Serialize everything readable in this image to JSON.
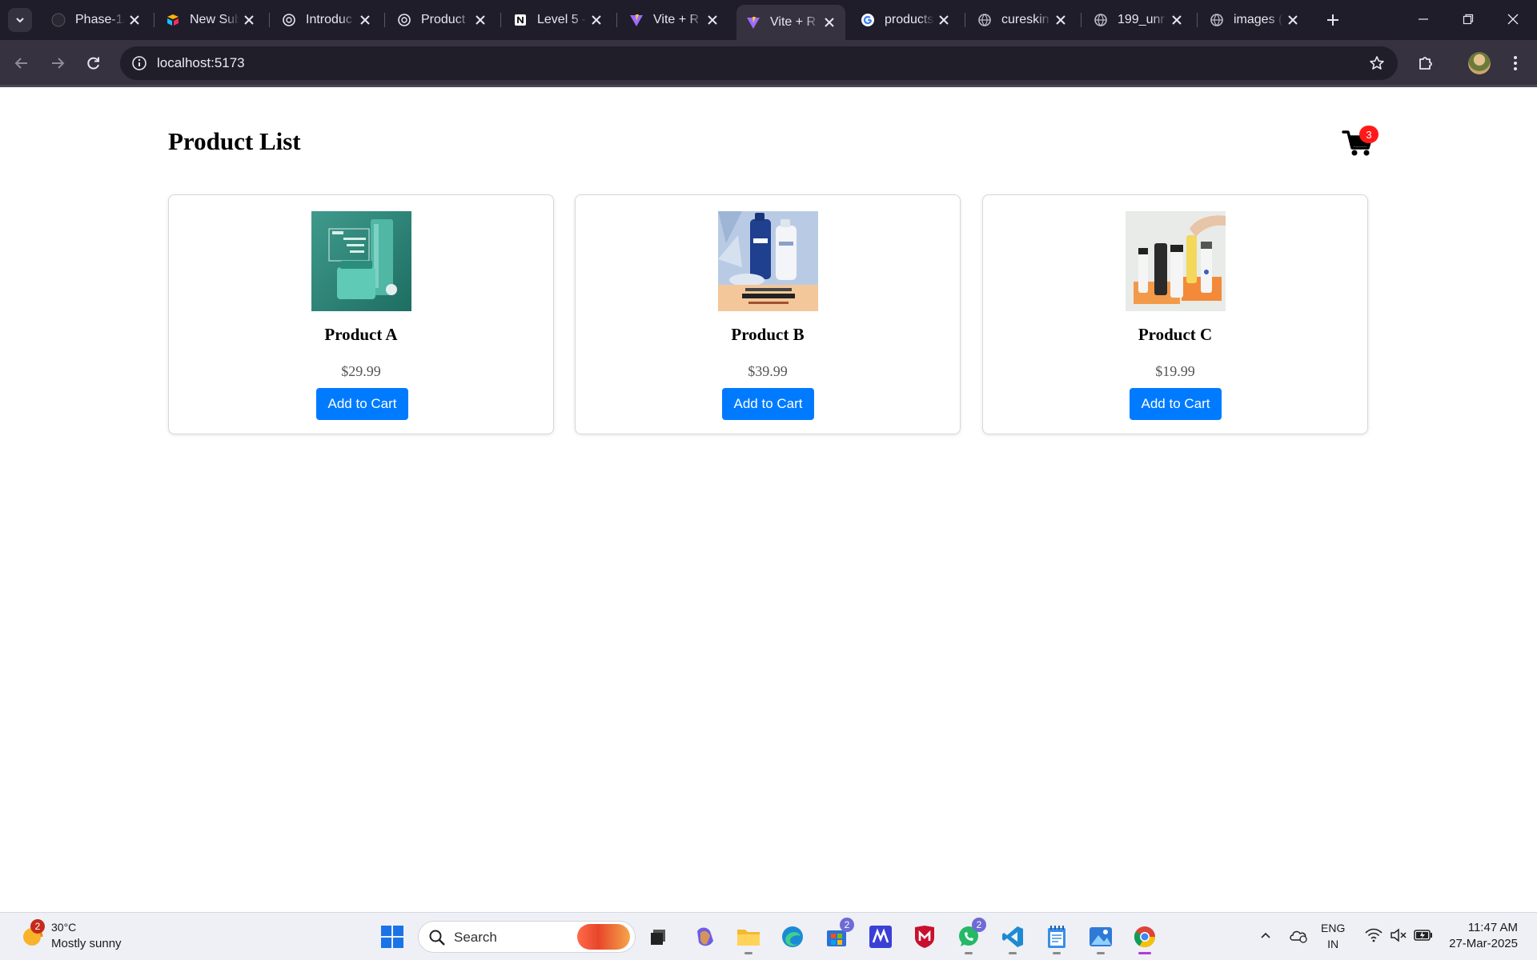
{
  "browser": {
    "tabs": [
      {
        "title": "Phase-1/",
        "favicon": "github-icon"
      },
      {
        "title": "New Sub",
        "favicon": "airtable-icon"
      },
      {
        "title": "Introduc",
        "favicon": "chatgpt-icon"
      },
      {
        "title": "Product",
        "favicon": "chatgpt-icon"
      },
      {
        "title": "Level 5 -",
        "favicon": "notion-icon"
      },
      {
        "title": "Vite + R",
        "favicon": "vite-icon"
      },
      {
        "title": "Vite + R",
        "favicon": "vite-icon",
        "active": true
      },
      {
        "title": "products",
        "favicon": "google-icon"
      },
      {
        "title": "cureskin",
        "favicon": "globe-icon"
      },
      {
        "title": "199_unr",
        "favicon": "globe-icon"
      },
      {
        "title": "images (",
        "favicon": "globe-icon"
      }
    ],
    "url": "localhost:5173"
  },
  "page": {
    "title": "Product List",
    "cart_count": "3",
    "add_label": "Add to Cart",
    "products": [
      {
        "name": "Product A",
        "price": "$29.99",
        "image": "teal-skincare-image"
      },
      {
        "name": "Product B",
        "price": "$39.99",
        "image": "nivea-dove-image"
      },
      {
        "name": "Product C",
        "price": "$19.99",
        "image": "cureskin-bottles-image"
      }
    ]
  },
  "taskbar": {
    "weather_badge": "2",
    "weather_temp": "30°C",
    "weather_desc": "Mostly sunny",
    "search_label": "Search",
    "store_badge": "2",
    "whatsapp_badge": "2",
    "lang_line1": "ENG",
    "lang_line2": "IN",
    "time": "11:47 AM",
    "date": "27-Mar-2025"
  },
  "colors": {
    "accent": "#007bff",
    "badge": "#ff1a1a",
    "tabstrip": "#1f1d29",
    "toolbar": "#36323f"
  }
}
